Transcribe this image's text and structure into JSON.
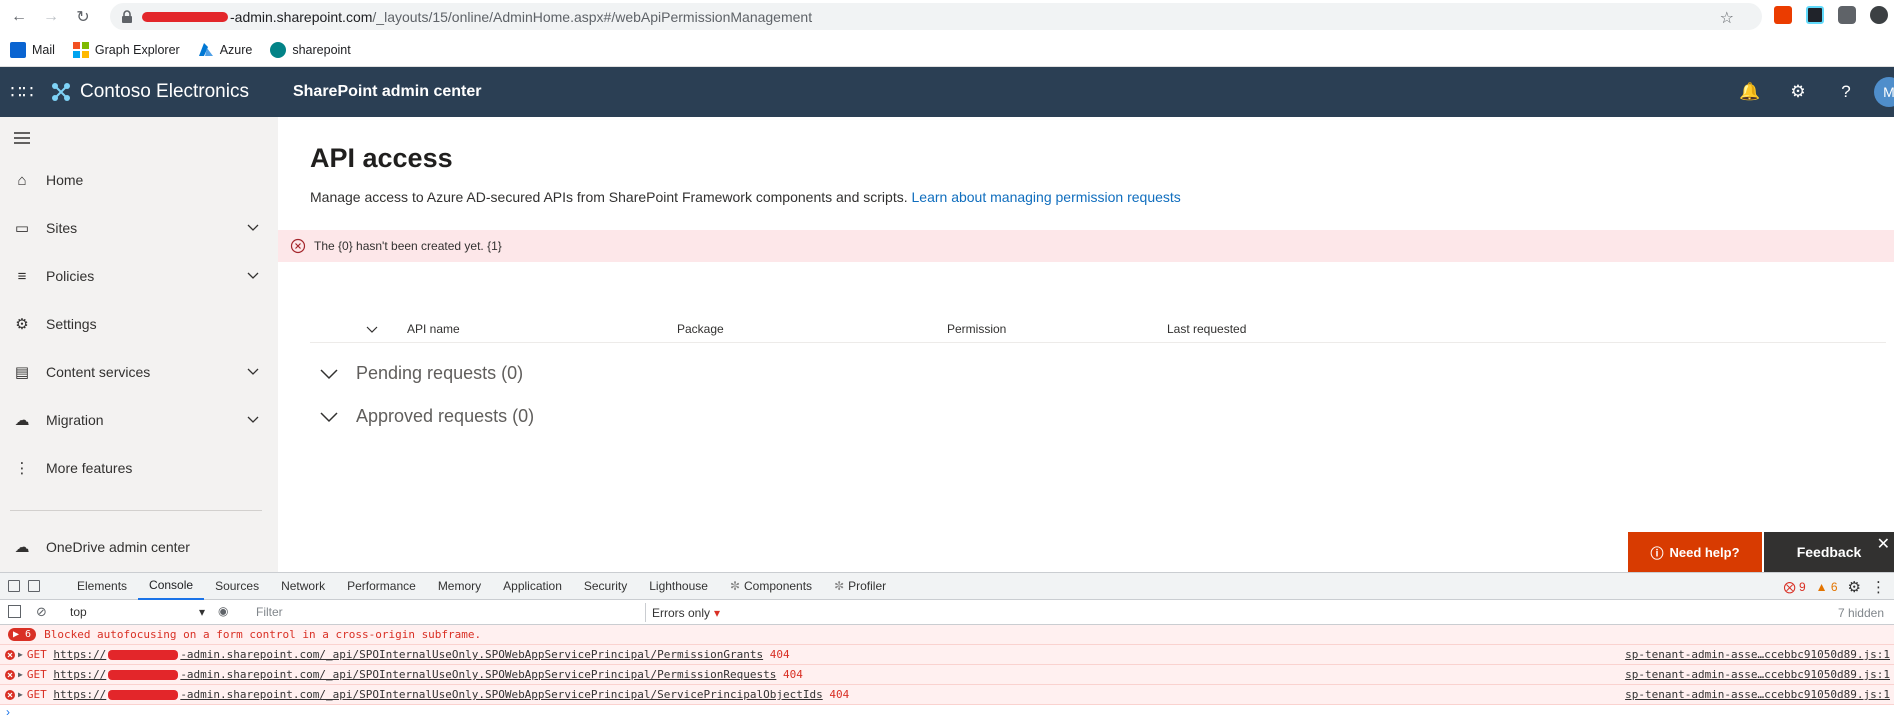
{
  "browser": {
    "url_host": "-admin.sharepoint.com",
    "url_path": "/_layouts/15/online/AdminHome.aspx#/webApiPermissionManagement",
    "bookmarks": [
      {
        "label": "Mail",
        "icon": "outlook-icon"
      },
      {
        "label": "Graph Explorer",
        "icon": "microsoft-icon"
      },
      {
        "label": "Azure",
        "icon": "azure-icon"
      },
      {
        "label": "sharepoint",
        "icon": "sharepoint-icon"
      }
    ]
  },
  "suite": {
    "brand": "Contoso Electronics",
    "app_name": "SharePoint admin center",
    "avatar_initial": "M"
  },
  "nav": {
    "items": [
      {
        "label": "Home",
        "icon": "home-icon",
        "expandable": false
      },
      {
        "label": "Sites",
        "icon": "sites-icon",
        "expandable": true
      },
      {
        "label": "Policies",
        "icon": "policies-icon",
        "expandable": true
      },
      {
        "label": "Settings",
        "icon": "gear-icon",
        "expandable": false
      },
      {
        "label": "Content services",
        "icon": "content-services-icon",
        "expandable": true
      },
      {
        "label": "Migration",
        "icon": "cloud-upload-icon",
        "expandable": true
      },
      {
        "label": "More features",
        "icon": "more-icon",
        "expandable": false
      }
    ],
    "footer_item": {
      "label": "OneDrive admin center",
      "icon": "onedrive-icon"
    }
  },
  "main": {
    "title": "API access",
    "description": "Manage access to Azure AD-secured APIs from SharePoint Framework components and scripts.",
    "learn_link": "Learn about managing permission requests",
    "error": "The {0} hasn't been created yet. {1}",
    "columns": [
      "API name",
      "Package",
      "Permission",
      "Last requested"
    ],
    "groups": [
      "Pending requests (0)",
      "Approved requests (0)"
    ],
    "help_button": "Need help?",
    "feedback_button": "Feedback"
  },
  "devtools": {
    "tabs": [
      "Elements",
      "Console",
      "Sources",
      "Network",
      "Performance",
      "Memory",
      "Application",
      "Security",
      "Lighthouse",
      "Components",
      "Profiler"
    ],
    "active_tab": "Console",
    "error_count": "9",
    "warning_count": "6",
    "context": "top",
    "filter_placeholder": "Filter",
    "levels": "Errors only",
    "hidden": "7 hidden",
    "logs": [
      {
        "kind": "grouped",
        "count": "6",
        "text": "Blocked autofocusing on a form control in a cross-origin subframe.",
        "source": ""
      },
      {
        "kind": "request",
        "method": "GET",
        "url_prefix": "https://",
        "url_rest": "-admin.sharepoint.com/_api/SPOInternalUseOnly.SPOWebAppServicePrincipal/PermissionGrants",
        "status": "404",
        "source": "sp-tenant-admin-asse…ccebbc91050d89.js:1"
      },
      {
        "kind": "request",
        "method": "GET",
        "url_prefix": "https://",
        "url_rest": "-admin.sharepoint.com/_api/SPOInternalUseOnly.SPOWebAppServicePrincipal/PermissionRequests",
        "status": "404",
        "source": "sp-tenant-admin-asse…ccebbc91050d89.js:1"
      },
      {
        "kind": "request",
        "method": "GET",
        "url_prefix": "https://",
        "url_rest": "-admin.sharepoint.com/_api/SPOInternalUseOnly.SPOWebAppServicePrincipal/ServicePrincipalObjectIds",
        "status": "404",
        "source": "sp-tenant-admin-asse…ccebbc91050d89.js:1"
      }
    ]
  },
  "colors": {
    "suite_bar": "#2b3f54",
    "link": "#106ebe",
    "error_bg": "#fde7e9",
    "help_button": "#d83b01",
    "feedback_button": "#323130"
  }
}
